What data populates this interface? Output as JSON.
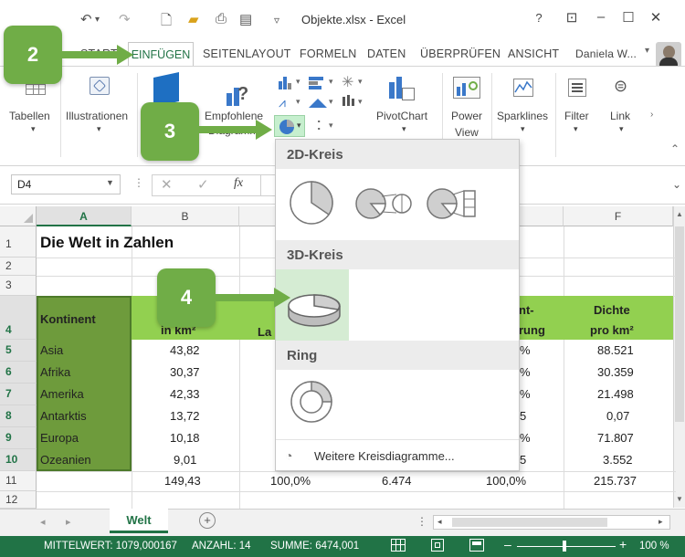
{
  "window": {
    "title": "Objekte.xlsx - Excel",
    "help": "?",
    "user": "Daniela W..."
  },
  "tabs": [
    "START",
    "EINFÜGEN",
    "SEITENLAYOUT",
    "FORMELN",
    "DATEN",
    "ÜBERPRÜFEN",
    "ANSICHT"
  ],
  "ribbon": {
    "tabellen": "Tabellen",
    "illustrationen": "Illustrationen",
    "empfohlene_1": "Empfohlene",
    "empfohlene_2": "Diagramme",
    "pivotchart": "PivotChart",
    "power_view_1": "Power",
    "power_view_2": "View",
    "sparklines": "Sparklines",
    "filter": "Filter",
    "link": "Link"
  },
  "formula_bar": {
    "name_box": "D4",
    "fx": "fx"
  },
  "columns": [
    "A",
    "B",
    "F"
  ],
  "sheet": {
    "title": "Die Welt in Zahlen",
    "header_a": "Kontinent",
    "header_b": "in km²",
    "header_c": "La",
    "header_e_1": "nt-",
    "header_e_2": "rung",
    "header_f_1": "Dichte",
    "header_f_2": "pro km²",
    "rows": [
      {
        "num": "5",
        "name": "Asia",
        "b": "43,82",
        "e": "%",
        "f": "88.521"
      },
      {
        "num": "6",
        "name": "Afrika",
        "b": "30,37",
        "e": "%",
        "f": "30.359"
      },
      {
        "num": "7",
        "name": "Amerika",
        "b": "42,33",
        "e": "%",
        "f": "21.498"
      },
      {
        "num": "8",
        "name": "Antarktis",
        "b": "13,72",
        "e": "5",
        "f": "0,07"
      },
      {
        "num": "9",
        "name": "Europa",
        "b": "10,18",
        "e": "%",
        "f": "71.807"
      },
      {
        "num": "10",
        "name": "Ozeanien",
        "b": "9,01",
        "e": "5",
        "f": "3.552"
      }
    ],
    "total": {
      "b": "149,43",
      "c": "100,0%",
      "d": "6.474",
      "e": "100,0%",
      "f": "215.737"
    },
    "row_numbers": [
      "1",
      "2",
      "3",
      "4",
      "11",
      "12"
    ]
  },
  "sheet_tab": "Welt",
  "status": {
    "mittelwert": "MITTELWERT: 1079,000167",
    "anzahl": "ANZAHL: 14",
    "summe": "SUMME: 6474,001",
    "zoom": "100 %"
  },
  "dropdown": {
    "section_2d": "2D-Kreis",
    "section_3d": "3D-Kreis",
    "section_ring": "Ring",
    "more": "Weitere Kreisdiagramme..."
  },
  "callouts": [
    "2",
    "3",
    "4"
  ],
  "colors": {
    "accent": "#217346",
    "callout": "#70ad47",
    "highlight_green": "#92d050",
    "dark_green_cell": "#6e9b3c"
  }
}
